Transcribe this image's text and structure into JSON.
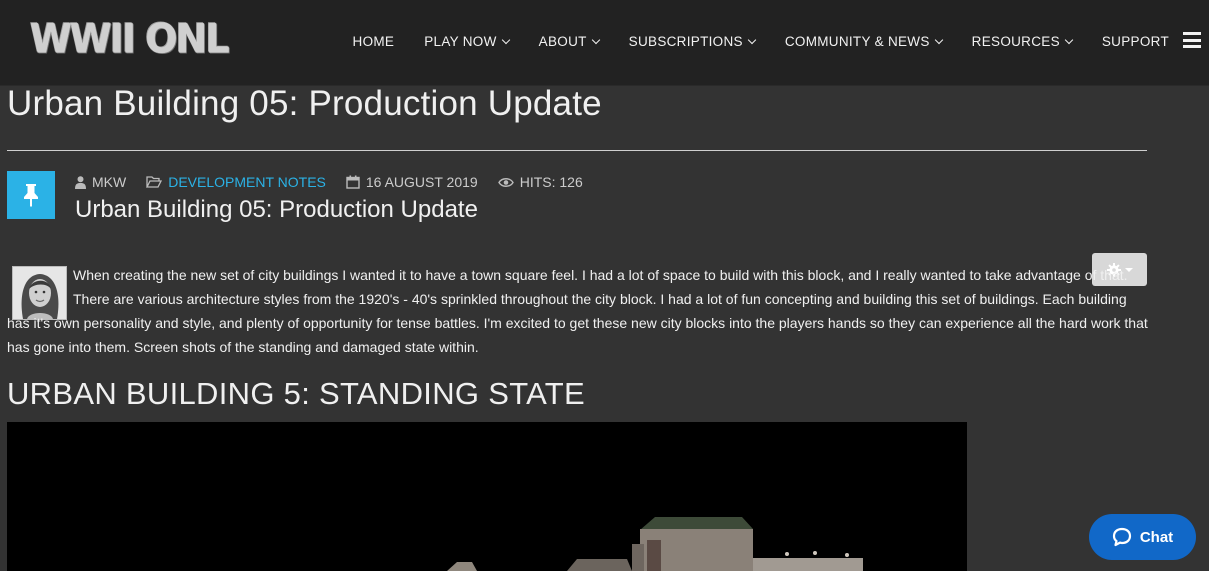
{
  "header": {
    "logo_text": "WWII ONLINE",
    "nav": [
      {
        "label": "HOME",
        "dropdown": false
      },
      {
        "label": "PLAY NOW",
        "dropdown": true
      },
      {
        "label": "ABOUT",
        "dropdown": true
      },
      {
        "label": "SUBSCRIPTIONS",
        "dropdown": true
      },
      {
        "label": "COMMUNITY & NEWS",
        "dropdown": true
      },
      {
        "label": "RESOURCES",
        "dropdown": true
      },
      {
        "label": "SUPPORT",
        "dropdown": false
      }
    ],
    "menu_icon": "hamburger-icon"
  },
  "page": {
    "title": "Urban Building 05: Production Update"
  },
  "article": {
    "pin_icon": "pushpin-icon",
    "meta": {
      "author": "MKW",
      "category": "DEVELOPMENT NOTES",
      "date": "16 AUGUST 2019",
      "hits": "HITS: 126"
    },
    "title": "Urban Building 05: Production Update",
    "body": "When creating the new set of city buildings I wanted it to have a town square feel. I had a lot of space to build with this block, and I really wanted to take advantage of that. There are various architecture styles from the 1920's - 40's sprinkled throughout the city block. I had a lot of fun concepting and building this set of buildings. Each building has it's own personality and style, and plenty of opportunity for tense battles. I'm excited to get these new city blocks into the players hands so they can experience all the hard work that has gone into them. Screen shots of the standing and damaged state within.",
    "section_heading": "URBAN BUILDING 5: STANDING STATE"
  },
  "chat": {
    "label": "Chat"
  },
  "colors": {
    "accent": "#2bb2e6",
    "header_bg": "#222222",
    "page_bg": "#333333",
    "chat_bg": "#1168c8"
  }
}
